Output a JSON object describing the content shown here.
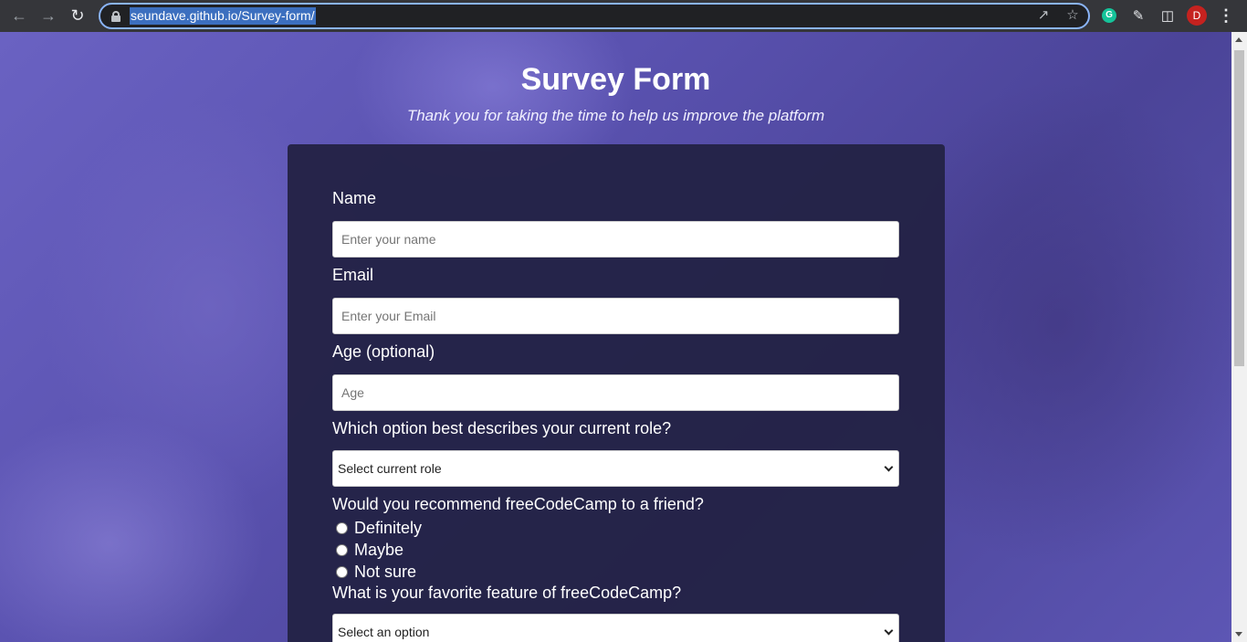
{
  "browser": {
    "url": "seundave.github.io/Survey-form/",
    "profile_initial": "D",
    "icons": [
      "back-arrow-icon",
      "forward-arrow-icon",
      "reload-icon",
      "lock-icon",
      "share-icon",
      "bookmark-star-icon",
      "grammarly-icon",
      "extensions-puzzle-icon",
      "side-panel-icon",
      "menu-kebab-icon"
    ]
  },
  "page": {
    "title": "Survey Form",
    "subtitle": "Thank you for taking the time to help us improve the platform"
  },
  "form": {
    "name": {
      "label": "Name",
      "placeholder": "Enter your name"
    },
    "email": {
      "label": "Email",
      "placeholder": "Enter your Email"
    },
    "age": {
      "label": "Age (optional)",
      "placeholder": "Age"
    },
    "role": {
      "label": "Which option best describes your current role?",
      "selected": "Select current role"
    },
    "recommend": {
      "label": "Would you recommend freeCodeCamp to a friend?",
      "options": [
        "Definitely",
        "Maybe",
        "Not sure"
      ]
    },
    "feature": {
      "label": "What is your favorite feature of freeCodeCamp?",
      "selected": "Select an option"
    }
  },
  "colors": {
    "card": "#232246",
    "accent": "#8ab4f8",
    "background": "#5a52b0"
  }
}
